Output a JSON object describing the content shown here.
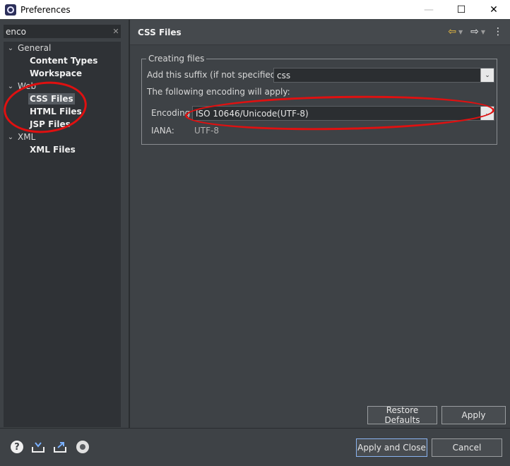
{
  "window": {
    "title": "Preferences",
    "minimize": "—",
    "maximize": "☐",
    "close": "✕"
  },
  "filter": {
    "value": "enco",
    "clear": "✕"
  },
  "tree": [
    {
      "id": "general",
      "label": "General",
      "toggle": "⌄",
      "kind": "category"
    },
    {
      "id": "content-types",
      "label": "Content Types",
      "kind": "leaf"
    },
    {
      "id": "workspace",
      "label": "Workspace",
      "kind": "leaf"
    },
    {
      "id": "web",
      "label": "Web",
      "toggle": "⌄",
      "kind": "category"
    },
    {
      "id": "css-files",
      "label": "CSS Files",
      "kind": "leaf",
      "selected": true
    },
    {
      "id": "html-files",
      "label": "HTML Files",
      "kind": "leaf"
    },
    {
      "id": "jsp-files",
      "label": "JSP Files",
      "kind": "leaf"
    },
    {
      "id": "xml",
      "label": "XML",
      "toggle": "⌄",
      "kind": "category"
    },
    {
      "id": "xml-files",
      "label": "XML Files",
      "kind": "leaf"
    }
  ],
  "page": {
    "title": "CSS Files",
    "nav": {
      "back": "⇦",
      "forward": "⇨",
      "menu": "⋮",
      "dropdown": "▼"
    },
    "group": {
      "legend": "Creating files",
      "suffix_label": "Add this suffix (if not specified):",
      "suffix_value": "css",
      "encoding_info": "The following encoding will apply:",
      "encoding_label": "Encoding",
      "encoding_value": "ISO 10646/Unicode(UTF-8)",
      "iana_label": "IANA:",
      "iana_value": "UTF-8",
      "combo_arrow": "⌄"
    },
    "buttons": {
      "restore_defaults": "Restore Defaults",
      "apply": "Apply"
    }
  },
  "footer": {
    "help": "?",
    "import_icon": "import-icon",
    "export_icon": "export-icon",
    "record_icon": "record-icon",
    "apply_and_close": "Apply and Close",
    "cancel": "Cancel"
  },
  "colors": {
    "background": "#3e4246",
    "tree_background": "#2f3236",
    "annotation": "#e01010",
    "primary_border": "#8ab4f0"
  }
}
